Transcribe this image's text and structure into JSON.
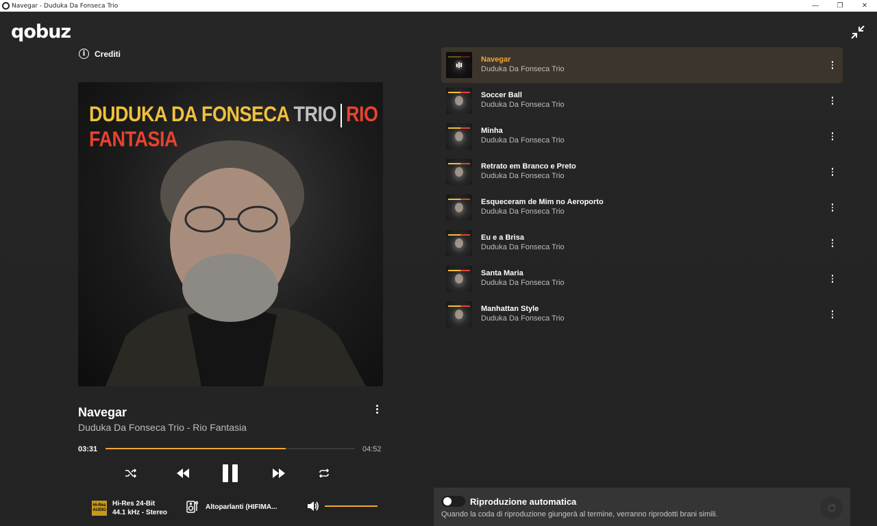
{
  "window": {
    "title": "Navegar - Duduka Da Fonseca Trio",
    "controls": {
      "minimize": "—",
      "restore": "❐",
      "close": "✕"
    }
  },
  "app": {
    "logo": "qobuz",
    "credits_label": "Crediti"
  },
  "album_cover": {
    "artist_main": "DUDUKA DA FONSECA",
    "artist_suffix": "TRIO",
    "album": "RIO FANTASIA"
  },
  "now_playing": {
    "title": "Navegar",
    "subtitle": "Duduka Da Fonseca Trio - Rio Fantasia",
    "current_time": "03:31",
    "total_time": "04:52",
    "progress": 0.723
  },
  "controls": {
    "shuffle_icon": "shuffle-icon",
    "previous_icon": "previous-icon",
    "play_pause_icon": "pause-icon",
    "next_icon": "next-icon",
    "repeat_icon": "repeat-icon"
  },
  "audio": {
    "badge_top": "Hi-Res",
    "badge_bottom": "AUDIO",
    "quality_line1": "Hi-Res 24-Bit",
    "quality_line2": "44.1 kHz - Stereo",
    "output": "Altoparlanti (HIFIMA...",
    "volume": 1.0
  },
  "queue": [
    {
      "title": "Navegar",
      "artist": "Duduka Da Fonseca Trio",
      "active": true
    },
    {
      "title": "Soccer Ball",
      "artist": "Duduka Da Fonseca Trio",
      "active": false
    },
    {
      "title": "Minha",
      "artist": "Duduka Da Fonseca Trio",
      "active": false
    },
    {
      "title": "Retrato em Branco e Preto",
      "artist": "Duduka Da Fonseca Trio",
      "active": false
    },
    {
      "title": "Esqueceram de Mim no Aeroporto",
      "artist": "Duduka Da Fonseca Trio",
      "active": false
    },
    {
      "title": "Eu e a Brisa",
      "artist": "Duduka Da Fonseca Trio",
      "active": false
    },
    {
      "title": "Santa Maria",
      "artist": "Duduka Da Fonseca Trio",
      "active": false
    },
    {
      "title": "Manhattan Style",
      "artist": "Duduka Da Fonseca Trio",
      "active": false
    }
  ],
  "autoplay": {
    "title": "Riproduzione automatica",
    "description": "Quando la coda di riproduzione giungerà al termine, verranno riprodotti brani simili.",
    "enabled": false
  },
  "colors": {
    "accent": "#f0a831",
    "background": "#242424",
    "active_row": "#3c352b",
    "cover_yellow": "#f0c13c",
    "cover_red": "#e8432f"
  }
}
